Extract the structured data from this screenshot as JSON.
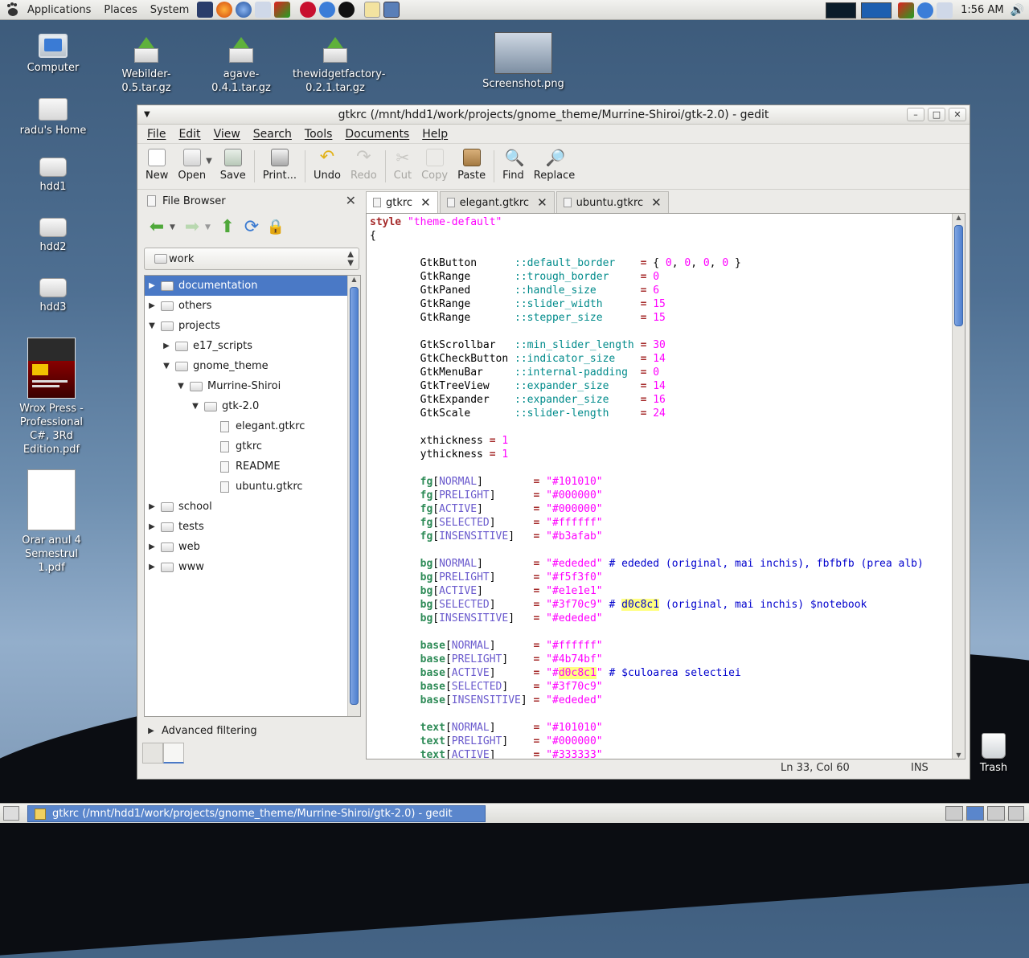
{
  "top_panel": {
    "menus": [
      "Applications",
      "Places",
      "System"
    ],
    "clock": "1:56 AM"
  },
  "desktop_icons": [
    {
      "label": "Computer"
    },
    {
      "label": "radu's Home"
    },
    {
      "label": "hdd1"
    },
    {
      "label": "hdd2"
    },
    {
      "label": "hdd3"
    },
    {
      "label": "Wrox Press - Professional C#, 3Rd Edition.pdf"
    },
    {
      "label": "Orar anul 4 Semestrul 1.pdf"
    },
    {
      "label": "Webilder-0.5.tar.gz"
    },
    {
      "label": "agave-0.4.1.tar.gz"
    },
    {
      "label": "thewidgetfactory-0.2.1.tar.gz"
    },
    {
      "label": "Screenshot.png"
    },
    {
      "label": "Trash"
    }
  ],
  "window": {
    "title": "gtkrc (/mnt/hdd1/work/projects/gnome_theme/Murrine-Shiroi/gtk-2.0) - gedit",
    "menu": [
      "File",
      "Edit",
      "View",
      "Search",
      "Tools",
      "Documents",
      "Help"
    ],
    "toolbar": {
      "new": "New",
      "open": "Open",
      "save": "Save",
      "print": "Print...",
      "undo": "Undo",
      "redo": "Redo",
      "cut": "Cut",
      "copy": "Copy",
      "paste": "Paste",
      "find": "Find",
      "replace": "Replace"
    }
  },
  "side_panel": {
    "title": "File Browser",
    "location": "work",
    "tree": [
      {
        "label": "documentation"
      },
      {
        "label": "others"
      },
      {
        "label": "projects"
      },
      {
        "label": "e17_scripts"
      },
      {
        "label": "gnome_theme"
      },
      {
        "label": "Murrine-Shiroi"
      },
      {
        "label": "gtk-2.0"
      },
      {
        "label": "elegant.gtkrc"
      },
      {
        "label": "gtkrc"
      },
      {
        "label": "README"
      },
      {
        "label": "ubuntu.gtkrc"
      },
      {
        "label": "school"
      },
      {
        "label": "tests"
      },
      {
        "label": "web"
      },
      {
        "label": "www"
      }
    ],
    "advanced_filtering": "Advanced filtering"
  },
  "editor": {
    "tabs": [
      "gtkrc",
      "elegant.gtkrc",
      "ubuntu.gtkrc"
    ],
    "status_position": "Ln 33, Col 60",
    "status_mode": "INS"
  },
  "taskbar": {
    "task": "gtkrc (/mnt/hdd1/work/projects/gnome_theme/Murrine-Shiroi/gtk-2.0) - gedit"
  }
}
